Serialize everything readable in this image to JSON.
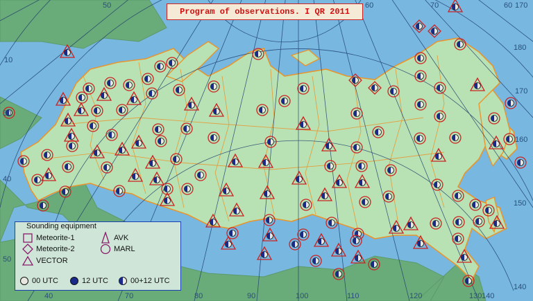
{
  "title": "Program of observations. I QR 2011",
  "grid_labels": {
    "top": [
      "50",
      "60",
      "70",
      "60",
      "170"
    ],
    "right": [
      "180",
      "170",
      "160",
      "150",
      "140"
    ],
    "left": [
      "10",
      "30",
      "40",
      "50"
    ],
    "bottom": [
      "40",
      "70",
      "80",
      "90",
      "100",
      "110",
      "120",
      "130",
      "140"
    ]
  },
  "legend": {
    "title": "Sounding equipment",
    "items": [
      {
        "shape": "square",
        "label": "Meteorite-1"
      },
      {
        "shape": "diamond",
        "label": "Meteorite-2"
      },
      {
        "shape": "triangle",
        "label": "VECTOR"
      },
      {
        "shape": "triangle-tall",
        "label": "AVK"
      },
      {
        "shape": "circle",
        "label": "MARL"
      }
    ],
    "times": [
      {
        "fill": "empty",
        "label": "00 UTC"
      },
      {
        "fill": "full",
        "label": "12 UTC"
      },
      {
        "fill": "half",
        "label": "00+12 UTC"
      }
    ]
  },
  "colors": {
    "sea": "#78b7e0",
    "land": "#6aab7a",
    "russia": "#b9e2b4",
    "border": "#e8952e",
    "marker_outline": "#cc2222",
    "station_fill": "#1a2a8a",
    "grid": "#1a3a6a"
  }
}
